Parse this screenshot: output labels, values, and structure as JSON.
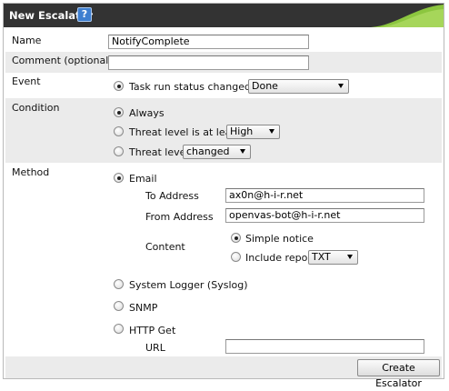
{
  "dialog": {
    "title": "New Escalator",
    "help_symbol": "?"
  },
  "name": {
    "label": "Name",
    "value": "NotifyComplete"
  },
  "comment": {
    "label": "Comment (optional)",
    "value": ""
  },
  "event": {
    "label": "Event",
    "option_label": "Task run status changed to",
    "selected": "Done"
  },
  "condition": {
    "label": "Condition",
    "always_label": "Always",
    "threat_at_least_label": "Threat level is at least",
    "threat_at_least_value": "High",
    "threat_level_label": "Threat level",
    "threat_level_value": "changed",
    "selected_option": "Always"
  },
  "method": {
    "label": "Method",
    "email_label": "Email",
    "to_label": "To Address",
    "to_value": "ax0n@h-i-r.net",
    "from_label": "From Address",
    "from_value": "openvas-bot@h-i-r.net",
    "content_label": "Content",
    "simple_notice_label": "Simple notice",
    "include_report_label": "Include report",
    "report_format": "TXT",
    "syslog_label": "System Logger (Syslog)",
    "snmp_label": "SNMP",
    "http_label": "HTTP Get",
    "url_label": "URL",
    "url_value": "",
    "selected_method": "Email",
    "selected_content": "Simple notice"
  },
  "actions": {
    "create_label": "Create Escalator"
  },
  "colors": {
    "titlebar": "#333333",
    "accent_green": "#8cc63f",
    "row_even": "#ebebeb"
  }
}
